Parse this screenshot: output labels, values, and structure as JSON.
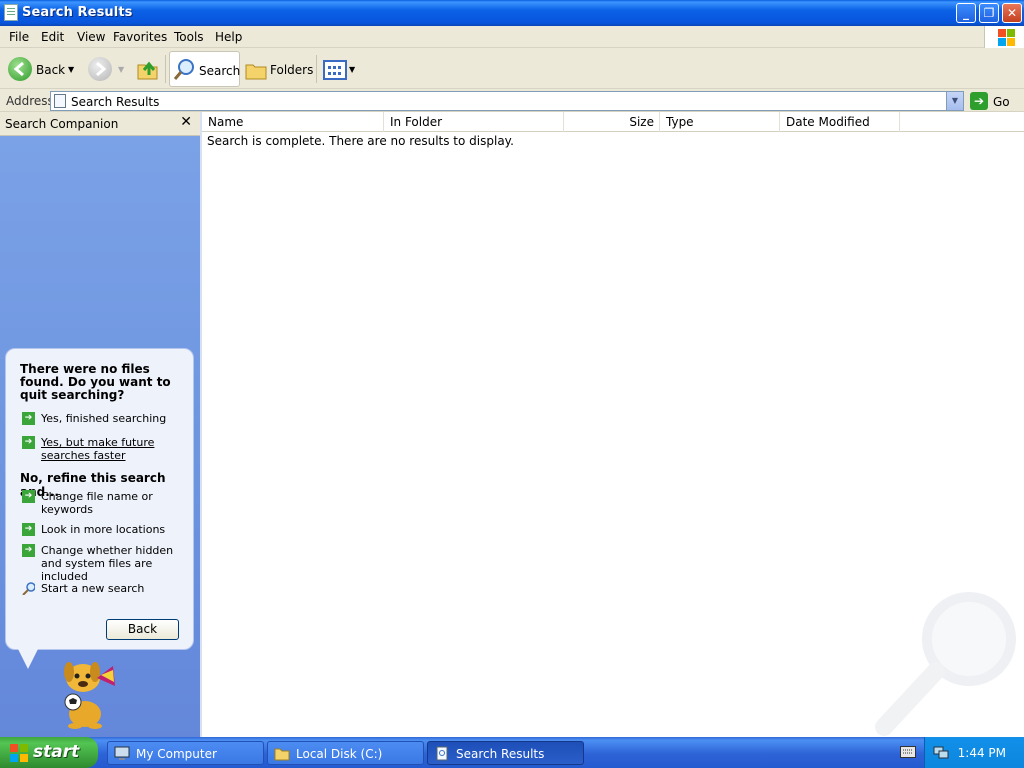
{
  "window": {
    "title": "Search Results",
    "controls": {
      "minimize": "_",
      "restore": "❐",
      "close": "✕"
    }
  },
  "menu": [
    "File",
    "Edit",
    "View",
    "Favorites",
    "Tools",
    "Help"
  ],
  "toolbar": {
    "back_label": "Back",
    "search_label": "Search",
    "folders_label": "Folders"
  },
  "address": {
    "label": "Address",
    "value": "Search Results",
    "go_label": "Go"
  },
  "search_companion": {
    "title": "Search Companion",
    "close": "✕",
    "question": "There were no files found. Do you want to quit searching?",
    "quit_options": [
      {
        "label": "Yes, finished searching",
        "icon": "green-arrow-icon"
      },
      {
        "label": "Yes, but make future searches faster",
        "icon": "green-arrow-icon"
      }
    ],
    "refine_heading": "No, refine this search and...",
    "refine_options": [
      {
        "label": "Change file name or keywords",
        "icon": "green-arrow-icon"
      },
      {
        "label": "Look in more locations",
        "icon": "green-arrow-icon"
      },
      {
        "label": "Change whether hidden and system files are included",
        "icon": "green-arrow-icon"
      }
    ],
    "new_search": "Start a new search",
    "back_button": "Back"
  },
  "results": {
    "columns": [
      "Name",
      "In Folder",
      "Size",
      "Type",
      "Date Modified"
    ],
    "message": "Search is complete. There are no results to display."
  },
  "taskbar": {
    "start_label": "start",
    "tasks": [
      {
        "label": "My Computer",
        "active": false
      },
      {
        "label": "Local Disk (C:)",
        "active": false
      },
      {
        "label": "Search Results",
        "active": true
      }
    ],
    "clock": "1:44 PM"
  },
  "colors": {
    "titlebar": "#0b61e5",
    "pane_blue": "#6e96e0",
    "start_green": "#3fa63f",
    "taskbar_blue": "#245ad0"
  }
}
